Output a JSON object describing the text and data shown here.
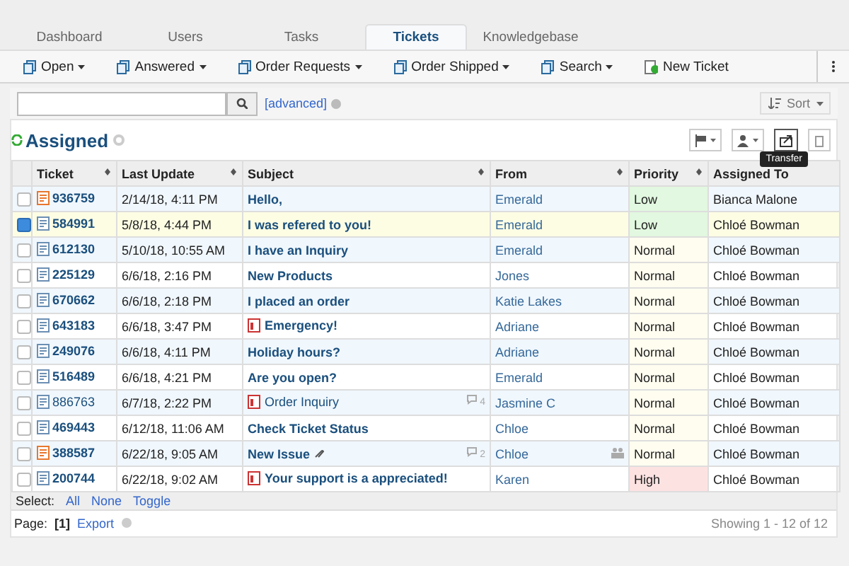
{
  "tabs": [
    {
      "label": "Dashboard",
      "selected": false
    },
    {
      "label": "Users",
      "selected": false
    },
    {
      "label": "Tasks",
      "selected": false
    },
    {
      "label": "Tickets",
      "selected": true
    },
    {
      "label": "Knowledgebase",
      "selected": false
    }
  ],
  "toolbar": [
    {
      "label": "Open",
      "kind": "menu"
    },
    {
      "label": "Answered",
      "kind": "menu"
    },
    {
      "label": "Order Requests",
      "kind": "menu"
    },
    {
      "label": "Order Shipped",
      "kind": "menu"
    },
    {
      "label": "Search",
      "kind": "menu"
    },
    {
      "label": "New Ticket",
      "kind": "new"
    }
  ],
  "search": {
    "advanced": "[advanced]",
    "sort": "Sort"
  },
  "heading": "Assigned",
  "tooltip": "Transfer",
  "columns": [
    "Ticket",
    "Last Update",
    "Subject",
    "From",
    "Priority",
    "Assigned To"
  ],
  "rows": [
    {
      "ticket": "936759",
      "updated": "2/14/18, 4:11 PM",
      "subject": "Hello,",
      "from": "Emerald",
      "priority": "Low",
      "color": "#e2f8e0",
      "assigned": "Bianca Malone",
      "selected": false,
      "unread": true,
      "new": true,
      "flagged": false
    },
    {
      "ticket": "584991",
      "updated": "5/8/18, 4:44 PM",
      "subject": "I was refered to you!",
      "from": "Emerald",
      "priority": "Low",
      "color": "#e2f8e0",
      "assigned": "Chloé Bowman",
      "selected": true,
      "unread": true,
      "new": false,
      "flagged": false
    },
    {
      "ticket": "612130",
      "updated": "5/10/18, 10:55 AM",
      "subject": "I have an Inquiry",
      "from": "Emerald",
      "priority": "Normal",
      "color": "#fffdf0",
      "assigned": "Chloé Bowman",
      "selected": false,
      "unread": true,
      "new": false,
      "flagged": false
    },
    {
      "ticket": "225129",
      "updated": "6/6/18, 2:16 PM",
      "subject": "New Products",
      "from": "Jones",
      "priority": "Normal",
      "color": "#fffdf0",
      "assigned": "Chloé Bowman",
      "selected": false,
      "unread": true,
      "new": false,
      "flagged": false
    },
    {
      "ticket": "670662",
      "updated": "6/6/18, 2:18 PM",
      "subject": "I placed an order",
      "from": "Katie Lakes",
      "priority": "Normal",
      "color": "#fffdf0",
      "assigned": "Chloé Bowman",
      "selected": false,
      "unread": true,
      "new": false,
      "flagged": false
    },
    {
      "ticket": "643183",
      "updated": "6/6/18, 3:47 PM",
      "subject": "Emergency!",
      "from": "Adriane",
      "priority": "Normal",
      "color": "#fffdf0",
      "assigned": "Chloé Bowman",
      "selected": false,
      "unread": true,
      "new": false,
      "flagged": true
    },
    {
      "ticket": "249076",
      "updated": "6/6/18, 4:11 PM",
      "subject": "Holiday hours?",
      "from": "Adriane",
      "priority": "Normal",
      "color": "#fffdf0",
      "assigned": "Chloé Bowman",
      "selected": false,
      "unread": true,
      "new": false,
      "flagged": false
    },
    {
      "ticket": "516489",
      "updated": "6/6/18, 4:21 PM",
      "subject": "Are you open?",
      "from": "Emerald",
      "priority": "Normal",
      "color": "#fffdf0",
      "assigned": "Chloé Bowman",
      "selected": false,
      "unread": true,
      "new": false,
      "flagged": false
    },
    {
      "ticket": "886763",
      "updated": "6/7/18, 2:22 PM",
      "subject": "Order Inquiry",
      "from": "Jasmine C",
      "priority": "Normal",
      "color": "#fffdf0",
      "assigned": "Chloé Bowman",
      "selected": false,
      "unread": false,
      "new": false,
      "flagged": true,
      "comments": "4"
    },
    {
      "ticket": "469443",
      "updated": "6/12/18, 11:06 AM",
      "subject": "Check Ticket Status",
      "from": "Chloe",
      "priority": "Normal",
      "color": "#fffdf0",
      "assigned": "Chloé Bowman",
      "selected": false,
      "unread": true,
      "new": false,
      "flagged": false
    },
    {
      "ticket": "388587",
      "updated": "6/22/18, 9:05 AM",
      "subject": "New Issue",
      "from": "Chloe",
      "priority": "Normal",
      "color": "#fffdf0",
      "assigned": "Chloé Bowman",
      "selected": false,
      "unread": true,
      "new": true,
      "flagged": false,
      "attachment": true,
      "comments": "2",
      "group": true
    },
    {
      "ticket": "200744",
      "updated": "6/22/18, 9:02 AM",
      "subject": "Your support is a appreciated!",
      "from": "Karen",
      "priority": "High",
      "color": "#fde2e2",
      "assigned": "Chloé Bowman",
      "selected": false,
      "unread": true,
      "new": false,
      "flagged": true
    }
  ],
  "select": {
    "label": "Select:",
    "links": [
      "All",
      "None",
      "Toggle"
    ]
  },
  "footer": {
    "page_label": "Page:",
    "page": "[1]",
    "export": "Export",
    "showing": "Showing 1 - 12 of 12"
  }
}
